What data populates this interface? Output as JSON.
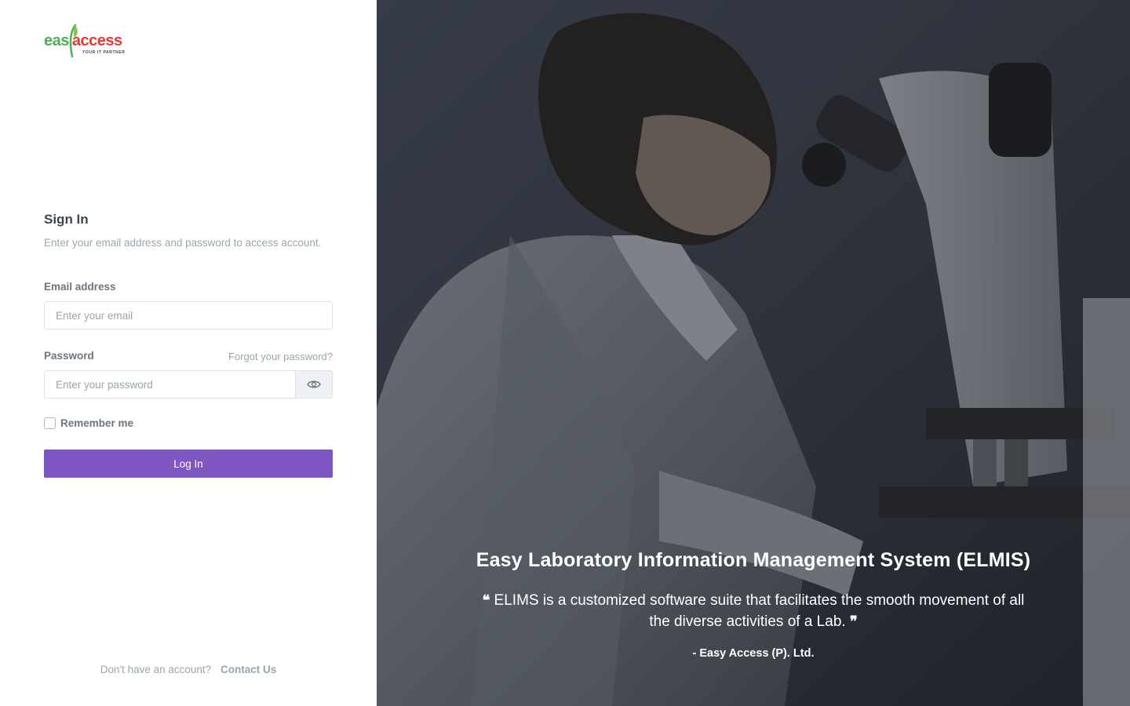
{
  "logo": {
    "brand_left": "eas",
    "brand_right": "access",
    "tagline": "YOUR IT PARTNER"
  },
  "signin": {
    "title": "Sign In",
    "subtitle": "Enter your email address and password to access account."
  },
  "form": {
    "email_label": "Email address",
    "email_placeholder": "Enter your email",
    "password_label": "Password",
    "forgot_label": "Forgot your password?",
    "password_placeholder": "Enter your password",
    "remember_label": "Remember me",
    "login_label": "Log In"
  },
  "footer": {
    "text": "Don't have an account?",
    "link_label": "Contact Us"
  },
  "hero": {
    "title": "Easy Laboratory Information Management System (ELMIS)",
    "quote": "ELIMS is a customized software suite that facilitates the smooth movement of all the diverse activities of a Lab.",
    "quote_open": "❝",
    "quote_close": "❞",
    "author": "- Easy Access (P). Ltd."
  },
  "colors": {
    "accent": "#7e57c2",
    "logo_green": "#4caf50",
    "logo_red": "#e53935"
  },
  "icons": {
    "password_toggle": "eye-icon",
    "logo_mark": "leaf-icon"
  }
}
